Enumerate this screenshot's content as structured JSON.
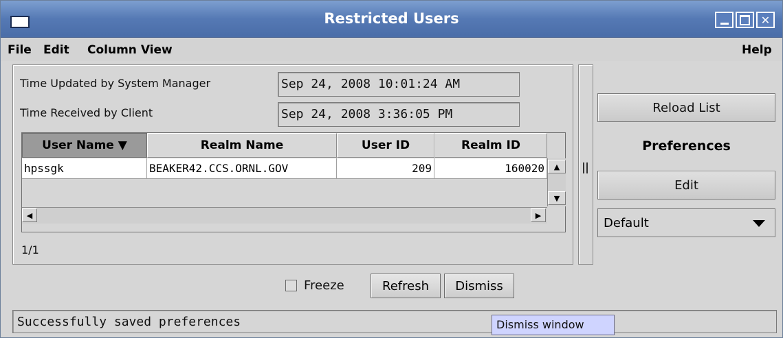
{
  "window": {
    "title": "Restricted Users"
  },
  "menu": {
    "file": "File",
    "edit": "Edit",
    "column_view": "Column View",
    "help": "Help"
  },
  "times": {
    "updated_label": "Time Updated by System Manager",
    "updated_value": "Sep 24, 2008 10:01:24 AM",
    "received_label": "Time Received by Client",
    "received_value": "Sep 24, 2008 3:36:05 PM"
  },
  "table": {
    "columns": [
      "User Name ▼",
      "Realm Name",
      "User ID",
      "Realm ID"
    ],
    "rows": [
      [
        "hpssgk",
        "BEAKER42.CCS.ORNL.GOV",
        "209",
        "160020"
      ]
    ],
    "count": "1/1"
  },
  "right": {
    "reload": "Reload List",
    "preferences_title": "Preferences",
    "edit": "Edit",
    "preset_selected": "Default"
  },
  "bottom": {
    "freeze_label": "Freeze",
    "freeze_checked": false,
    "refresh": "Refresh",
    "dismiss": "Dismiss"
  },
  "status": {
    "message": "Successfully saved preferences",
    "tooltip": "Dismiss window"
  },
  "icons": {
    "window": "window-icon",
    "minimize": "minimize-icon",
    "maximize": "maximize-icon",
    "close": "close-icon",
    "sort": "sort-desc-icon",
    "scroll_up": "arrow-up-icon",
    "scroll_down": "arrow-down-icon",
    "scroll_left": "arrow-left-icon",
    "scroll_right": "arrow-right-icon",
    "dropdown": "chevron-down-icon"
  },
  "colors": {
    "title_bar": "#5579b4",
    "tooltip_bg": "#cfd4ff",
    "sorted_header": "#9a9a9a"
  }
}
